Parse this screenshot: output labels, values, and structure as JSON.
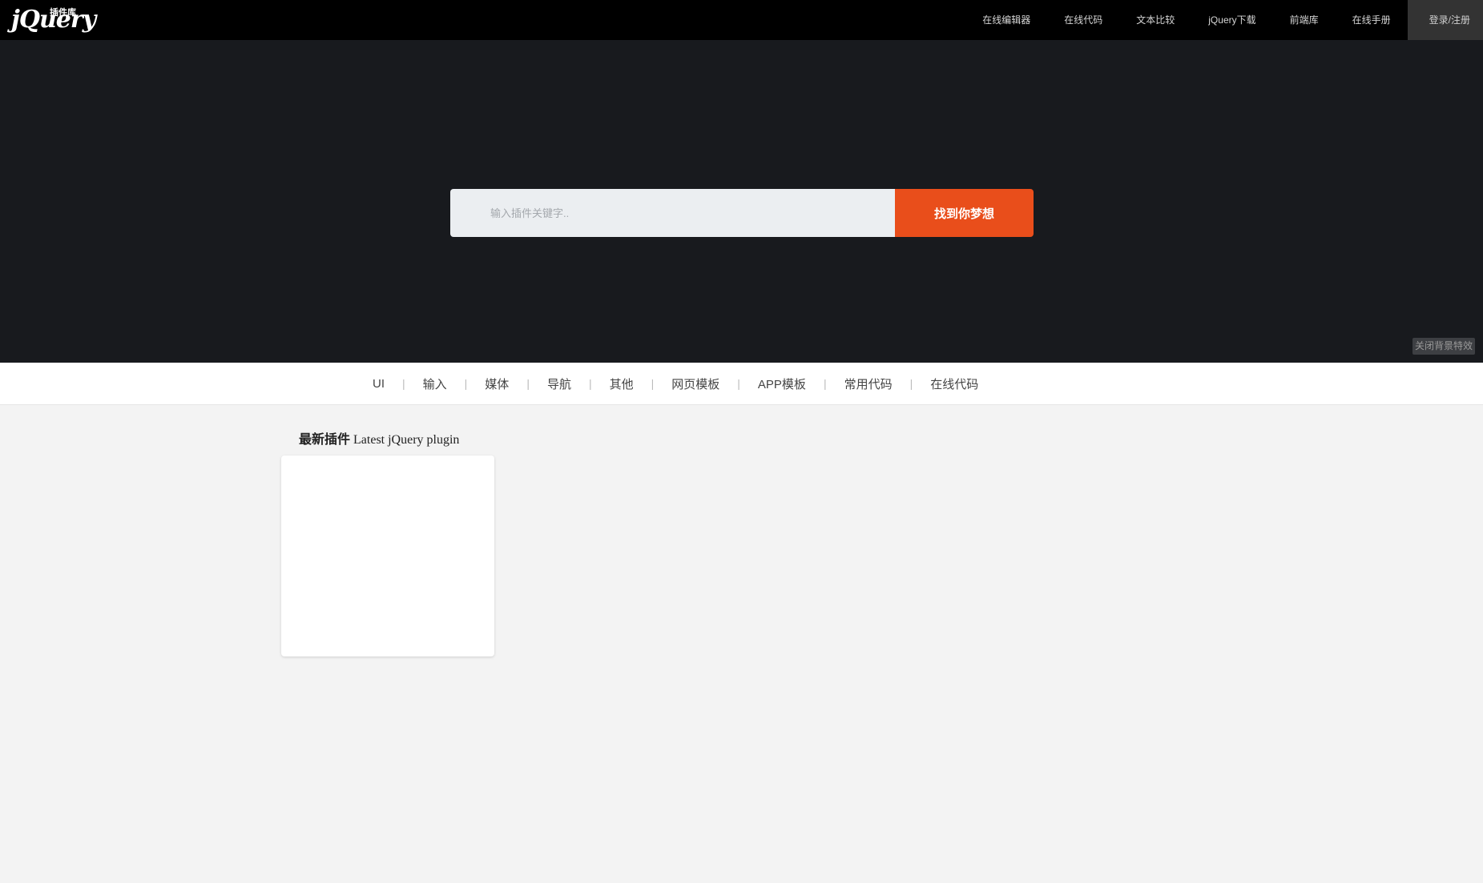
{
  "header": {
    "logo_text": "jQuery",
    "logo_subtext": "插件库",
    "nav": [
      {
        "label": "在线编辑器"
      },
      {
        "label": "在线代码"
      },
      {
        "label": "文本比较"
      },
      {
        "label": "jQuery下载"
      },
      {
        "label": "前端库"
      },
      {
        "label": "在线手册"
      },
      {
        "label": "登录/注册"
      }
    ]
  },
  "hero": {
    "search_placeholder": "输入插件关键字..",
    "search_button": "找到你梦想",
    "bg_toggle": "关闭背景特效"
  },
  "categories": [
    {
      "label": "UI"
    },
    {
      "label": "输入"
    },
    {
      "label": "媒体"
    },
    {
      "label": "导航"
    },
    {
      "label": "其他"
    },
    {
      "label": "网页模板"
    },
    {
      "label": "APP模板"
    },
    {
      "label": "常用代码"
    },
    {
      "label": "在线代码"
    }
  ],
  "section": {
    "title_zh": "最新插件",
    "title_en": "Latest jQuery plugin"
  }
}
